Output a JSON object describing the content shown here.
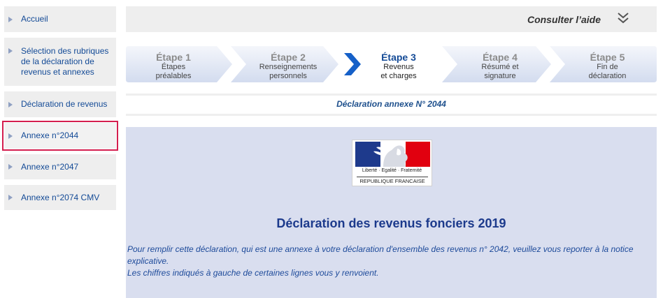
{
  "sidebar": {
    "items": [
      {
        "label": "Accueil"
      },
      {
        "label": "Sélection des rubriques de la déclaration de revenus et annexes"
      },
      {
        "label": "Déclaration de revenus"
      },
      {
        "label": "Annexe n°2044"
      },
      {
        "label": "Annexe n°2047"
      },
      {
        "label": "Annexe n°2074 CMV"
      }
    ],
    "selected_index": 3
  },
  "help": {
    "label": "Consulter l’aide",
    "icon": "double-chevron-down-icon"
  },
  "steps": [
    {
      "title": "Étape 1",
      "desc1": "Étapes",
      "desc2": "préalables"
    },
    {
      "title": "Étape 2",
      "desc1": "Renseignements",
      "desc2": "personnels"
    },
    {
      "title": "Étape 3",
      "desc1": "Revenus",
      "desc2": "et charges"
    },
    {
      "title": "Étape 4",
      "desc1": "Résumé et",
      "desc2": "signature"
    },
    {
      "title": "Étape 5",
      "desc1": "Fin de",
      "desc2": "déclaration"
    }
  ],
  "current_step": 3,
  "annex_title": "Déclaration annexe N° 2044",
  "logo": {
    "motto": "Liberté · Egalité · Fraternité",
    "republic": "REPUBLIQUE FRANCAISE"
  },
  "main": {
    "title": "Déclaration des revenus fonciers 2019",
    "intro_line1": "Pour remplir cette déclaration, qui est une annexe à votre déclaration d'ensemble des revenus n° 2042, veuillez vous reporter à la notice explicative.",
    "intro_line2": "Les chiffres indiqués à gauche de certaines lignes vous y renvoient."
  },
  "colors": {
    "link_blue": "#134a96",
    "panel_bg": "#d9deef",
    "highlight_border": "#d41e4e",
    "step_current_arrow": "#1560c8"
  }
}
